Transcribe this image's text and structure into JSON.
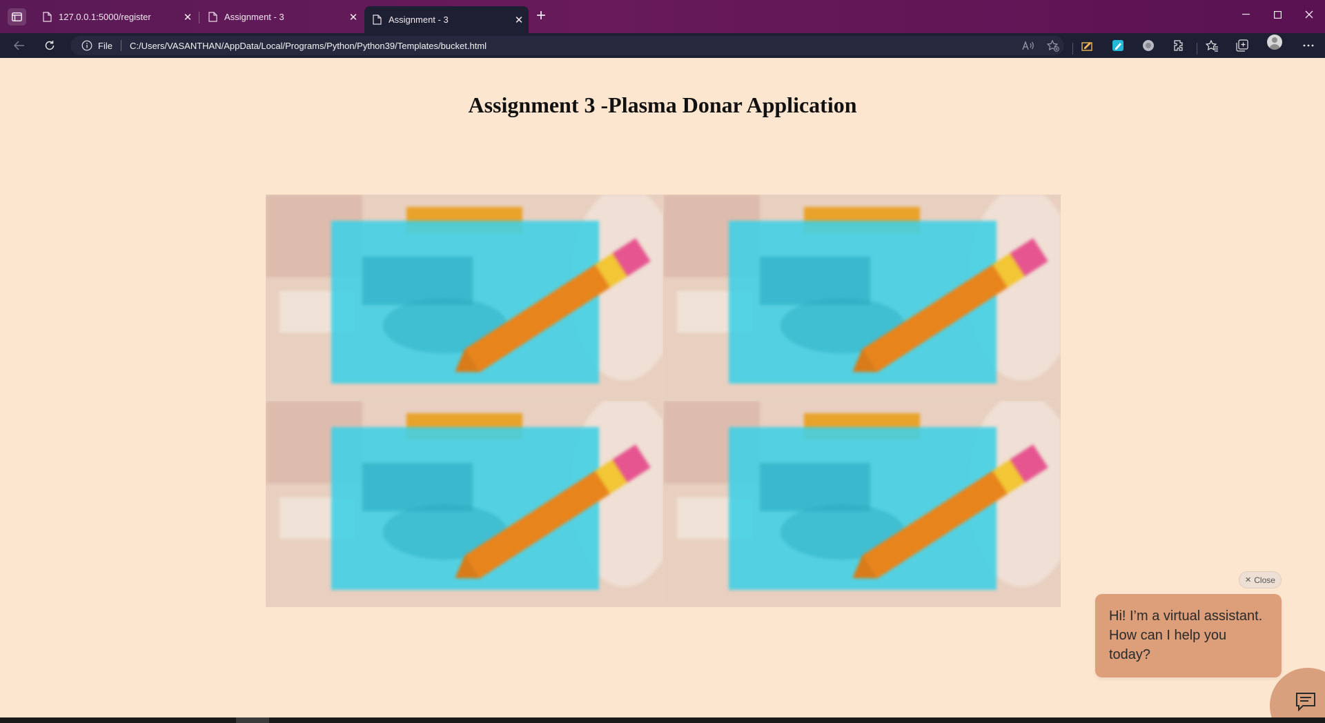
{
  "browser": {
    "tabs": [
      {
        "title": "127.0.0.1:5000/register",
        "close": "✕"
      },
      {
        "title": "Assignment - 3",
        "close": "✕"
      },
      {
        "title": "Assignment - 3",
        "close": "✕"
      }
    ],
    "new_tab": "+",
    "window_controls": {
      "minimize": "—",
      "maximize": "☐",
      "close": "✕"
    },
    "address": {
      "scheme_label": "File",
      "url": "C:/Users/VASANTHAN/AppData/Local/Programs/Python/Python39/Templates/bucket.html"
    },
    "toolbar_icons": [
      "back-icon",
      "refresh-icon",
      "info-icon",
      "read-aloud-icon",
      "add-favorite-icon",
      "reading-icon",
      "extension-icon",
      "circle-extension-icon",
      "extensions-icon",
      "favorites-icon",
      "collections-icon",
      "profile-icon",
      "more-icon"
    ]
  },
  "page": {
    "title": "Assignment 3 -Plasma Donar Application",
    "tiles": [
      {
        "name": "bucket-image-1"
      },
      {
        "name": "bucket-image-2"
      },
      {
        "name": "bucket-image-3"
      },
      {
        "name": "bucket-image-4"
      }
    ],
    "theme": {
      "background": "#fde6cf",
      "accent": "#dd9e7a"
    }
  },
  "chat": {
    "close_label": "Close",
    "close_icon": "✕",
    "message": "Hi! I’m a virtual assistant. How can I help you today?"
  }
}
